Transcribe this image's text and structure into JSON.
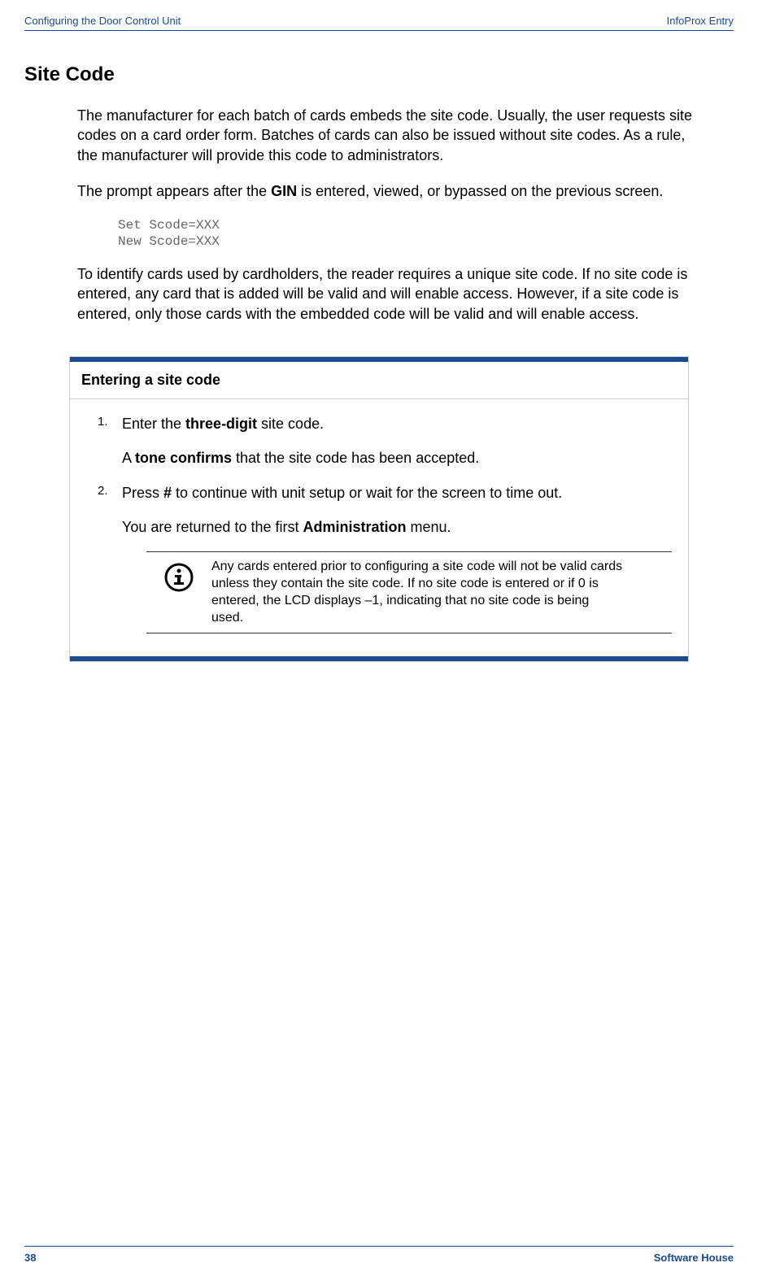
{
  "header": {
    "left": "Configuring the Door Control Unit",
    "right": "InfoProx Entry"
  },
  "section_title": "Site Code",
  "para1": "The manufacturer for each batch of cards embeds the site code. Usually, the user requests site codes on a card order form. Batches of cards can also be issued without site codes. As a rule, the manufacturer will provide this code to administrators.",
  "para2_a": "The prompt appears after the ",
  "para2_b_bold": "GIN",
  "para2_c": " is entered, viewed, or bypassed on the previous screen.",
  "code_block": "Set Scode=XXX\nNew Scode=XXX",
  "para3": "To identify cards used by cardholders, the reader requires a unique site code. If no site code is entered, any card that is added will be valid and will enable access. However, if a site code is entered, only those cards with the embedded code will be valid and will enable access.",
  "procedure": {
    "title": "Entering a site code",
    "step1_num": "1.",
    "step1_a": "Enter the ",
    "step1_b_bold": "three-digit",
    "step1_c": " site code.",
    "step1_sub_a": "A ",
    "step1_sub_b_bold": "tone confirms",
    "step1_sub_c": " that the site code has been accepted.",
    "step2_num": "2.",
    "step2_a": "Press ",
    "step2_b_bold": "#",
    "step2_c": " to continue with unit setup or wait for the screen to time out.",
    "step2_sub_a": "You are returned to the first ",
    "step2_sub_b_bold": "Administration",
    "step2_sub_c": " menu.",
    "note": "Any cards entered prior to configuring a site code will not be valid cards unless they contain the site code. If no site code is entered or if 0 is entered, the LCD displays –1, indicating that no site code is being used."
  },
  "footer": {
    "page": "38",
    "brand": "Software House"
  }
}
